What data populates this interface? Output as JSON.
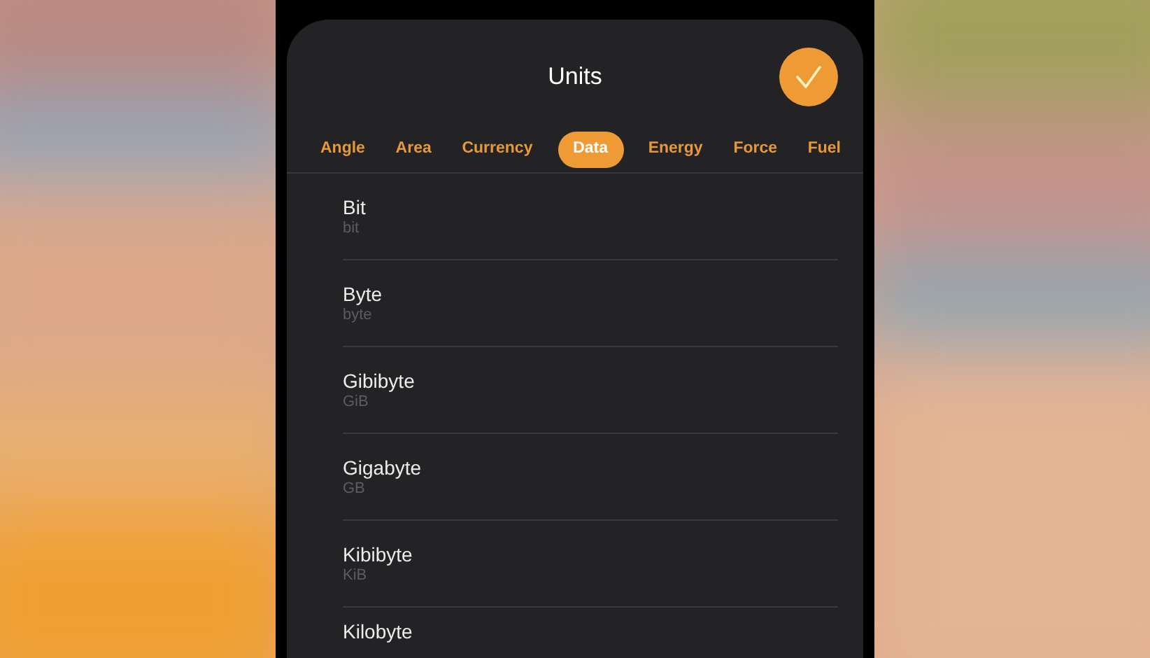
{
  "sheet": {
    "title": "Units"
  },
  "tabs": [
    {
      "label": "Angle",
      "selected": false
    },
    {
      "label": "Area",
      "selected": false
    },
    {
      "label": "Currency",
      "selected": false
    },
    {
      "label": "Data",
      "selected": true
    },
    {
      "label": "Energy",
      "selected": false
    },
    {
      "label": "Force",
      "selected": false
    },
    {
      "label": "Fuel",
      "selected": false
    }
  ],
  "units": [
    {
      "name": "Bit",
      "symbol": "bit"
    },
    {
      "name": "Byte",
      "symbol": "byte"
    },
    {
      "name": "Gibibyte",
      "symbol": "GiB"
    },
    {
      "name": "Gigabyte",
      "symbol": "GB"
    },
    {
      "name": "Kibibyte",
      "symbol": "KiB"
    },
    {
      "name": "Kilobyte"
    }
  ]
}
